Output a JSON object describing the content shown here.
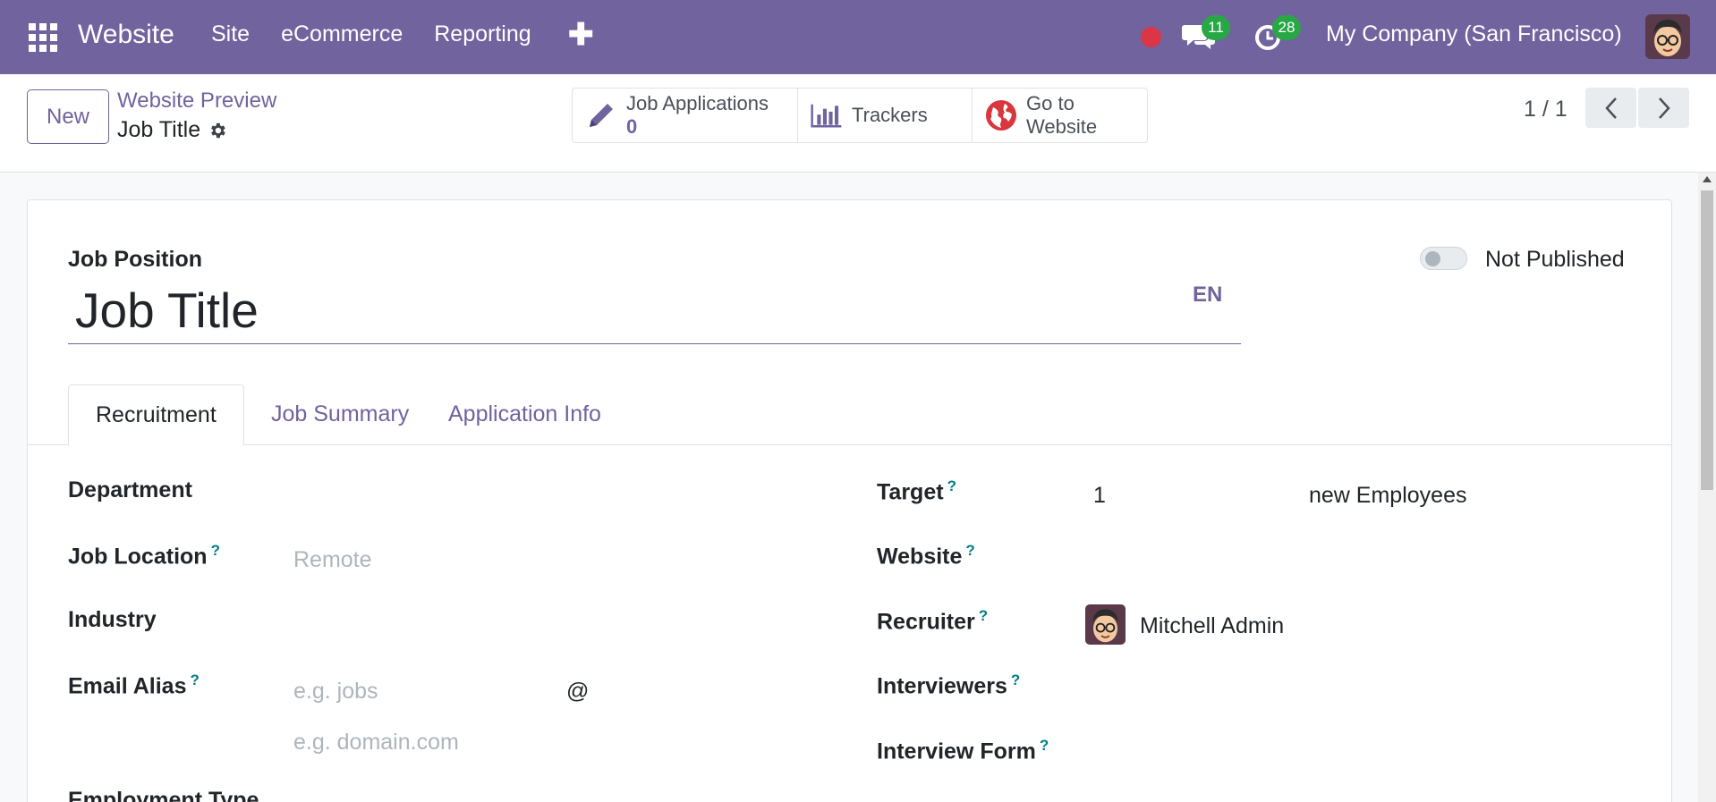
{
  "navbar": {
    "app_title": "Website",
    "menu": [
      "Site",
      "eCommerce",
      "Reporting"
    ],
    "messages_count": "11",
    "activities_count": "28",
    "company": "My Company (San Francisco)",
    "bg_color": "#71639e"
  },
  "control_panel": {
    "new_label": "New",
    "breadcrumb": "Website Preview",
    "record_name": "Job Title",
    "stat_buttons": {
      "applications_label": "Job Applications",
      "applications_value": "0",
      "trackers_label": "Trackers",
      "goto_line1": "Go to",
      "goto_line2": "Website"
    },
    "pager": "1 / 1"
  },
  "form": {
    "job_position_label": "Job Position",
    "job_title_value": "Job Title",
    "lang": "EN",
    "publish_status": "Not Published",
    "tabs": [
      "Recruitment",
      "Job Summary",
      "Application Info"
    ],
    "left_fields": {
      "department": "Department",
      "job_location": "Job Location",
      "job_location_placeholder": "Remote",
      "industry": "Industry",
      "email_alias": "Email Alias",
      "email_alias_placeholder": "e.g. jobs",
      "at_sign": "@",
      "domain_placeholder": "e.g. domain.com",
      "employment_type": "Employment Type"
    },
    "right_fields": {
      "target": "Target",
      "target_value": "1",
      "target_unit": "new Employees",
      "website": "Website",
      "recruiter": "Recruiter",
      "recruiter_value": "Mitchell Admin",
      "interviewers": "Interviewers",
      "interview_form": "Interview Form"
    },
    "help_mark": "?"
  }
}
